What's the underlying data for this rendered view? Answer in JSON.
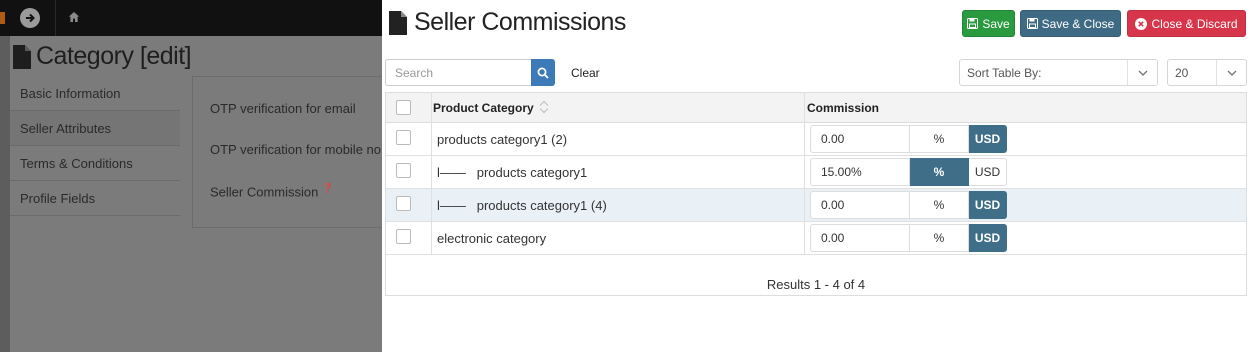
{
  "background": {
    "page_title": "Category [edit]",
    "nav": [
      {
        "label": "Basic Information"
      },
      {
        "label": "Seller Attributes"
      },
      {
        "label": "Terms & Conditions"
      },
      {
        "label": "Profile Fields"
      }
    ],
    "form_labels": [
      {
        "label": "OTP verification for email"
      },
      {
        "label": "OTP verification for mobile no."
      },
      {
        "label": "Seller Commission"
      }
    ]
  },
  "modal": {
    "title": "Seller Commissions",
    "buttons": {
      "save": "Save",
      "save_close": "Save & Close",
      "close_discard": "Close & Discard"
    },
    "search": {
      "placeholder": "Search",
      "value": "",
      "clear_label": "Clear"
    },
    "sort": {
      "label": "Sort Table By:"
    },
    "page_size": {
      "value": "20"
    },
    "table": {
      "headers": {
        "category": "Product Category",
        "commission": "Commission"
      },
      "rows": [
        {
          "category": "products category1 (2)",
          "value": "0.00",
          "percent": "%",
          "currency": "USD",
          "active_unit": "USD"
        },
        {
          "category": "l——   products category1",
          "value": "15.00%",
          "percent": "%",
          "currency": "USD",
          "active_unit": "%"
        },
        {
          "category": "l——   products category1 (4)",
          "value": "0.00",
          "percent": "%",
          "currency": "USD",
          "active_unit": "USD"
        },
        {
          "category": "electronic category",
          "value": "0.00",
          "percent": "%",
          "currency": "USD",
          "active_unit": "USD"
        }
      ],
      "results": "Results 1 - 4 of 4"
    }
  },
  "colors": {
    "save": "#2a9a3e",
    "save_close": "#3f6a83",
    "close_discard": "#d7364a",
    "search_button": "#3d7ab8",
    "toggle_active": "#3f6f88",
    "row_highlight": "#e9f0f6"
  }
}
